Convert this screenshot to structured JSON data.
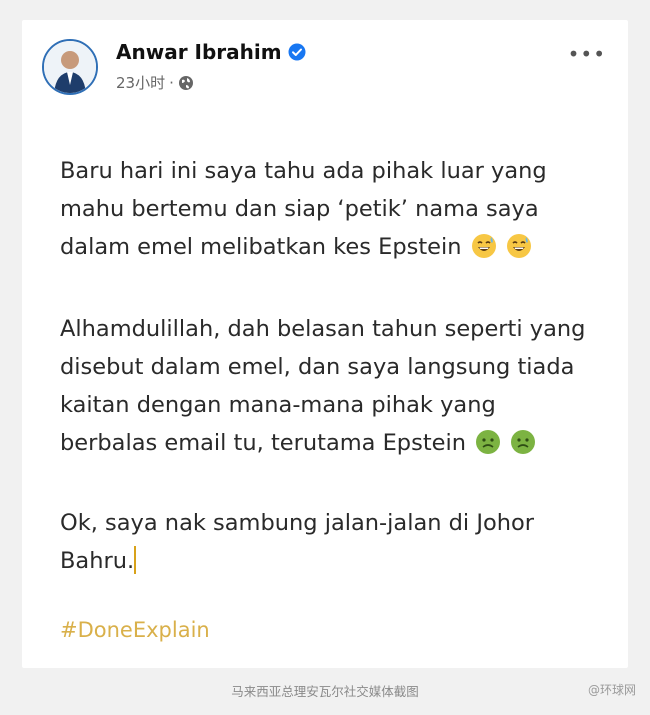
{
  "post": {
    "author_name": "Anwar Ibrahim",
    "time": "23小时",
    "separator": "·",
    "more_label": "•••",
    "paragraph1": "Baru hari ini saya tahu ada pihak luar yang mahu bertemu dan siap ‘petik’ nama saya dalam emel melibatkan kes Epstein",
    "paragraph2": "Alhamdulillah, dah belasan tahun seperti yang disebut dalam emel, dan saya langsung tiada kaitan dengan mana-mana pihak yang berbalas email tu, terutama Epstein",
    "paragraph3": "Ok, saya nak sambung jalan-jalan di Johor Bahru.",
    "hashtag": "#DoneExplain"
  },
  "caption": "马来西亚总理安瓦尔社交媒体截图",
  "watermark": "@环球网",
  "colors": {
    "verified_blue": "#1877f2",
    "hashtag_gold": "#d9b04a",
    "text": "#2a2a2a"
  },
  "icons": [
    "verified-badge-icon",
    "globe-icon",
    "more-options-icon",
    "grinning-sweat-emoji",
    "nauseated-face-emoji"
  ]
}
